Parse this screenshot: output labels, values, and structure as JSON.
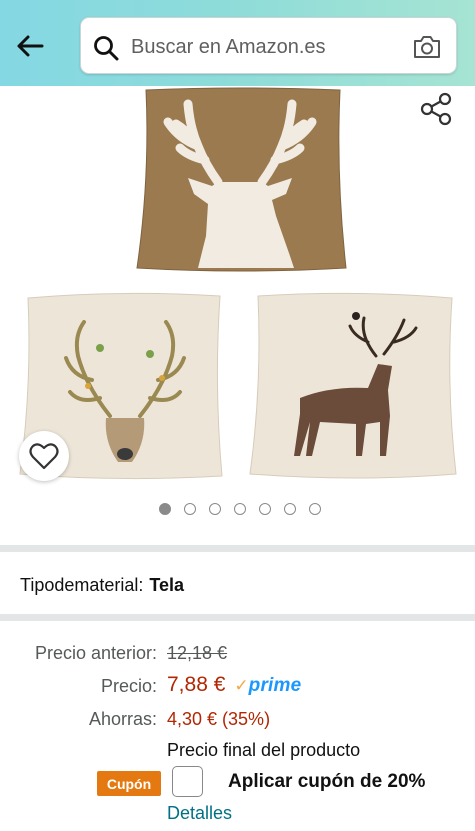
{
  "header": {
    "back_icon": "arrow-left-icon",
    "search_placeholder": "Buscar en Amazon.es",
    "search_icon": "search-icon",
    "camera_icon": "camera-icon"
  },
  "gallery": {
    "image_count": 7,
    "active_index": 0,
    "share_icon": "share-icon",
    "favorite_icon": "heart-icon"
  },
  "attributes": {
    "material_label": "Tipodematerial:",
    "material_value": "Tela"
  },
  "pricing": {
    "old_price_label": "Precio anterior:",
    "old_price": "12,18 €",
    "price_label": "Precio:",
    "price": "7,88 €",
    "prime_check": "✓",
    "prime_label": "prime",
    "savings_label": "Ahorras:",
    "savings": "4,30 € (35%)",
    "final_note": "Precio final del producto"
  },
  "coupon": {
    "badge": "Cupón",
    "text": "Aplicar cupón de 20%",
    "details_link": "Detalles",
    "checked": false
  },
  "colors": {
    "price_red": "#b12704",
    "link_teal": "#007185",
    "coupon_orange": "#e47911",
    "prime_blue": "#1a98ff",
    "header_gradient_start": "#84d8e3",
    "header_gradient_end": "#a6e4d3"
  }
}
